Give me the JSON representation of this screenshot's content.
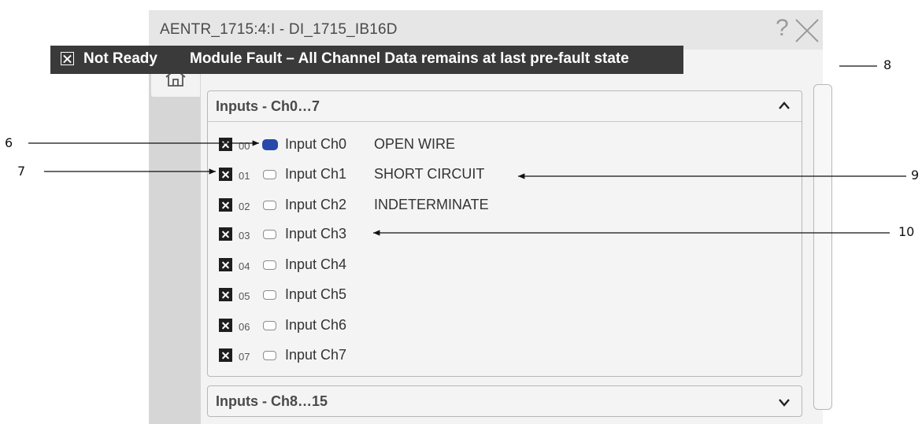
{
  "window": {
    "title": "AENTR_1715:4:I - DI_1715_IB16D",
    "help_glyph": "?"
  },
  "status_bar": {
    "state": "Not Ready",
    "message": "Module Fault – All Channel Data remains at last pre-fault state"
  },
  "sections": [
    {
      "title": "Inputs - Ch0…7",
      "expanded": true,
      "channels": [
        {
          "number": "00",
          "label": "Input Ch0",
          "led_on": true,
          "status": "OPEN WIRE"
        },
        {
          "number": "01",
          "label": "Input Ch1",
          "led_on": false,
          "status": "SHORT CIRCUIT"
        },
        {
          "number": "02",
          "label": "Input Ch2",
          "led_on": false,
          "status": "INDETERMINATE"
        },
        {
          "number": "03",
          "label": "Input Ch3",
          "led_on": false,
          "status": ""
        },
        {
          "number": "04",
          "label": "Input Ch4",
          "led_on": false,
          "status": ""
        },
        {
          "number": "05",
          "label": "Input Ch5",
          "led_on": false,
          "status": ""
        },
        {
          "number": "06",
          "label": "Input Ch6",
          "led_on": false,
          "status": ""
        },
        {
          "number": "07",
          "label": "Input Ch7",
          "led_on": false,
          "status": ""
        }
      ]
    },
    {
      "title": "Inputs - Ch8…15",
      "expanded": false
    }
  ],
  "callouts": {
    "c6": "6",
    "c7": "7",
    "c8": "8",
    "c9": "9",
    "c10": "10"
  },
  "colors": {
    "led_on": "#2748a8",
    "status_bar_bg": "#3a3a3a"
  }
}
